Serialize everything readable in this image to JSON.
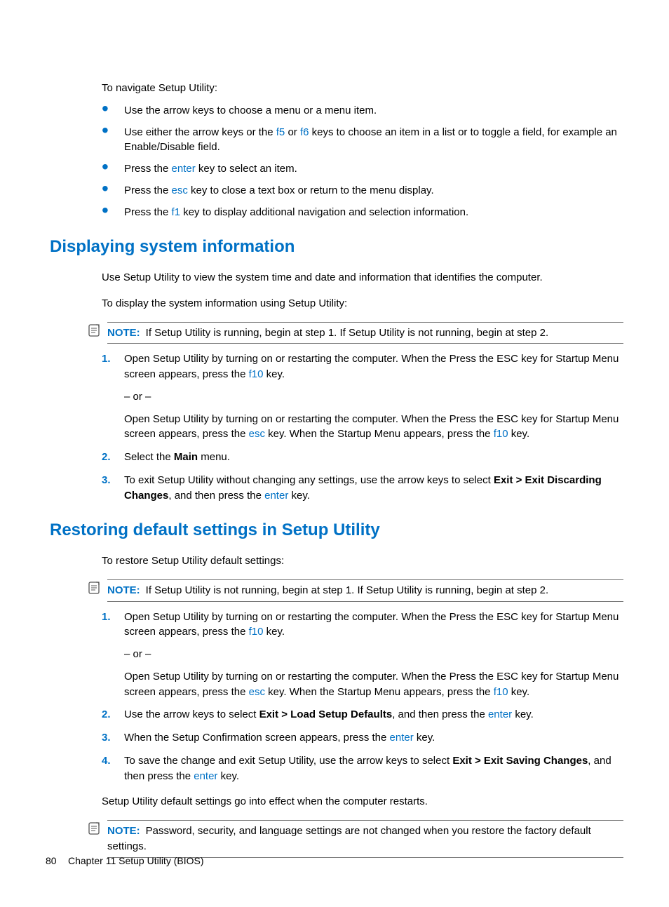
{
  "intro": "To navigate Setup Utility:",
  "bullets": {
    "b1": "Use the arrow keys to choose a menu or a menu item.",
    "b2a": "Use either the arrow keys or the ",
    "b2f5": "f5",
    "b2or": " or ",
    "b2f6": "f6",
    "b2b": " keys to choose an item in a list or to toggle a field, for example an Enable/Disable field.",
    "b3a": "Press the ",
    "b3key": "enter",
    "b3b": " key to select an item.",
    "b4a": "Press the ",
    "b4key": "esc",
    "b4b": " key to close a text box or return to the menu display.",
    "b5a": "Press the ",
    "b5key": "f1",
    "b5b": " key to display additional navigation and selection information."
  },
  "h1": "Displaying system information",
  "s1": {
    "p1": "Use Setup Utility to view the system time and date and information that identifies the computer.",
    "p2": "To display the system information using Setup Utility:",
    "noteLabel": "NOTE:",
    "noteText": "If Setup Utility is running, begin at step 1. If Setup Utility is not running, begin at step 2.",
    "step1a": "Open Setup Utility by turning on or restarting the computer. When the Press the ESC key for Startup Menu screen appears, press the ",
    "step1k": "f10",
    "step1b": " key.",
    "or": "– or –",
    "step1c": "Open Setup Utility by turning on or restarting the computer. When the Press the ESC key for Startup Menu screen appears, press the ",
    "step1k2": "esc",
    "step1d": " key. When the Startup Menu appears, press the ",
    "step1k3": "f10",
    "step1e": " key.",
    "step2a": "Select the ",
    "step2b": "Main",
    "step2c": " menu.",
    "step3a": "To exit Setup Utility without changing any settings, use the arrow keys to select ",
    "step3b": "Exit > Exit Discarding Changes",
    "step3c": ", and then press the ",
    "step3k": "enter",
    "step3d": " key."
  },
  "h2": "Restoring default settings in Setup Utility",
  "s2": {
    "p1": "To restore Setup Utility default settings:",
    "noteLabel": "NOTE:",
    "noteText": "If Setup Utility is not running, begin at step 1. If Setup Utility is running, begin at step 2.",
    "step1a": "Open Setup Utility by turning on or restarting the computer. When the Press the ESC key for Startup Menu screen appears, press the ",
    "step1k": "f10",
    "step1b": " key.",
    "or": "– or –",
    "step1c": "Open Setup Utility by turning on or restarting the computer. When the Press the ESC key for Startup Menu screen appears, press the ",
    "step1k2": "esc",
    "step1d": " key. When the Startup Menu appears, press the ",
    "step1k3": "f10",
    "step1e": " key.",
    "step2a": "Use the arrow keys to select ",
    "step2b": "Exit > Load Setup Defaults",
    "step2c": ", and then press the ",
    "step2k": "enter",
    "step2d": " key.",
    "step3a": "When the Setup Confirmation screen appears, press the ",
    "step3k": "enter",
    "step3b": " key.",
    "step4a": "To save the change and exit Setup Utility, use the arrow keys to select ",
    "step4b": "Exit > Exit Saving Changes",
    "step4c": ", and then press the ",
    "step4k": "enter",
    "step4d": " key.",
    "p2": "Setup Utility default settings go into effect when the computer restarts.",
    "note2Label": "NOTE:",
    "note2Text": "Password, security, and language settings are not changed when you restore the factory default settings."
  },
  "footer": {
    "page": "80",
    "chapter": "Chapter 11   Setup Utility (BIOS)"
  }
}
